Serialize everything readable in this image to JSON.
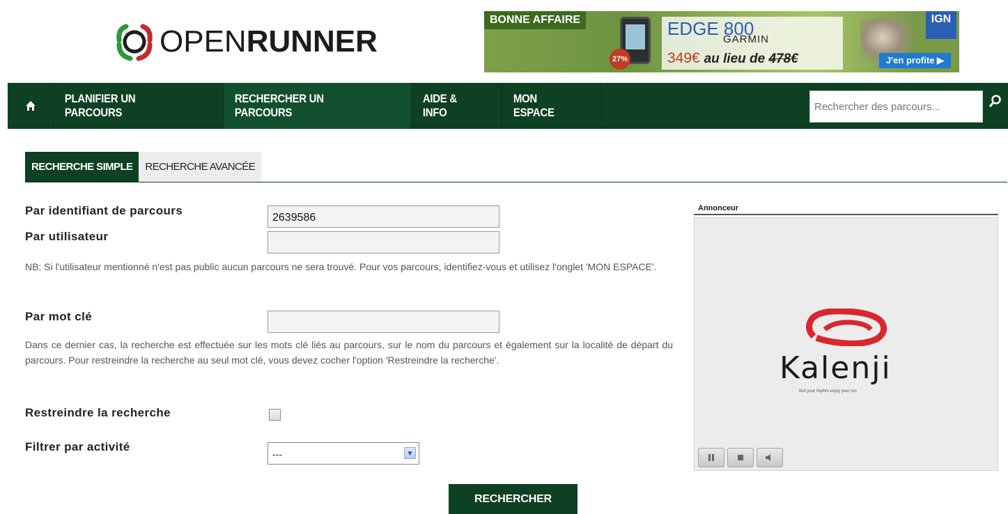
{
  "header": {
    "logo_light": "OPEN",
    "logo_bold": "RUNNER",
    "banner": {
      "tag": "BONNE AFFAIRE",
      "discount": "27%",
      "model": "EDGE 800",
      "brand": "GARMIN",
      "price_new": "349€",
      "price_text": "au lieu de",
      "price_old": "478€",
      "publisher": "IGN",
      "cta": "J'en profite ▶"
    }
  },
  "nav": {
    "items": [
      {
        "label": "PLANIFIER UN PARCOURS"
      },
      {
        "label": "RECHERCHER UN PARCOURS"
      },
      {
        "label": "AIDE & INFO"
      },
      {
        "label": "MON ESPACE"
      }
    ],
    "search_placeholder": "Rechercher des parcours..."
  },
  "tabs": {
    "simple": "RECHERCHE SIMPLE",
    "advanced": "RECHERCHE AVANCÉE"
  },
  "form": {
    "id_label": "Par identifiant de parcours",
    "id_value": "2639586",
    "user_label": "Par utilisateur",
    "user_value": "",
    "user_note": "NB: Si l'utilisateur mentionné n'est pas public aucun parcours ne sera trouvé. Pour vos parcours, identifiez-vous et utilisez l'onglet 'MON ESPACE'.",
    "keyword_label": "Par mot clé",
    "keyword_value": "",
    "keyword_note": "Dans ce dernier cas, la recherche est effectuée sur les mots clé liés au parcours, sur le nom du parcours et également sur la localité de départ du parcours. Pour restreindre la recherche au seul mot clé, vous devez cocher l'option 'Restreindre la recherche'.",
    "restrict_label": "Restreindre la recherche",
    "restrict_checked": false,
    "activity_label": "Filtrer par activité",
    "activity_selected": "---",
    "submit_label": "RECHERCHER"
  },
  "ad": {
    "title": "Annonceur",
    "brand": "Kalenji",
    "tagline": "find your rhythm enjoy your run"
  },
  "colors": {
    "primary_green": "#0e4024",
    "active_green": "#124f2e"
  }
}
